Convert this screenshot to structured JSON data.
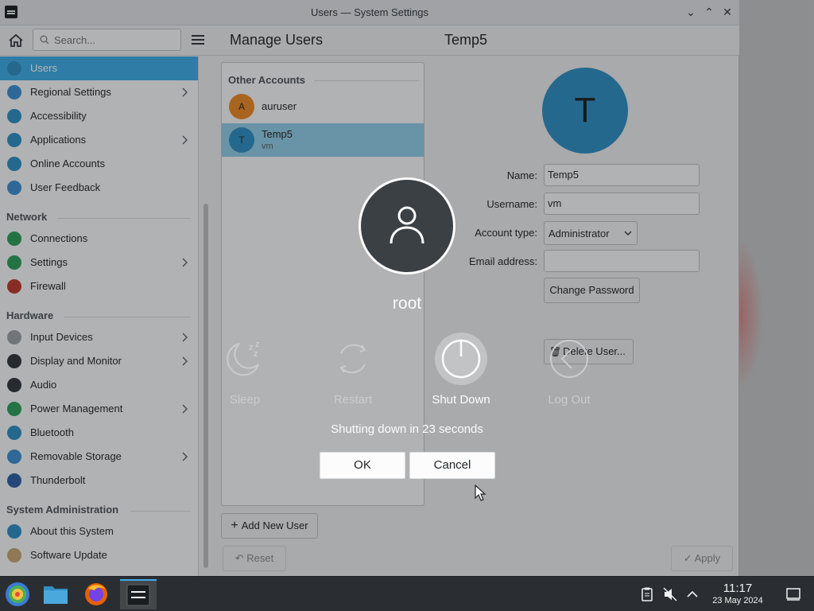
{
  "window": {
    "title": "Users — System Settings"
  },
  "toolbar": {
    "search_placeholder": "Search...",
    "page_title": "Manage Users",
    "user_title": "Temp5"
  },
  "sidebar": {
    "items_top": [
      {
        "label": "Users",
        "icon": "users-icon",
        "color": "#2e8fc4",
        "selected": true,
        "has_children": false
      },
      {
        "label": "Regional Settings",
        "icon": "regional-settings-icon",
        "color": "#3d8fd1",
        "selected": false,
        "has_children": true
      },
      {
        "label": "Accessibility",
        "icon": "accessibility-icon",
        "color": "#2e8fc4",
        "selected": false,
        "has_children": false
      },
      {
        "label": "Applications",
        "icon": "applications-icon",
        "color": "#2e8fc4",
        "selected": false,
        "has_children": true
      },
      {
        "label": "Online Accounts",
        "icon": "online-accounts-icon",
        "color": "#2e8fc4",
        "selected": false,
        "has_children": false
      },
      {
        "label": "User Feedback",
        "icon": "user-feedback-icon",
        "color": "#3d8fd1",
        "selected": false,
        "has_children": false
      }
    ],
    "network_header": "Network",
    "items_network": [
      {
        "label": "Connections",
        "icon": "globe-icon",
        "color": "#2ca05a",
        "has_children": false
      },
      {
        "label": "Settings",
        "icon": "globe-icon",
        "color": "#2ca05a",
        "has_children": true
      },
      {
        "label": "Firewall",
        "icon": "firewall-icon",
        "color": "#c0392b",
        "has_children": false
      }
    ],
    "hardware_header": "Hardware",
    "items_hardware": [
      {
        "label": "Input Devices",
        "icon": "mouse-icon",
        "color": "#9ea3a8",
        "has_children": true
      },
      {
        "label": "Display and Monitor",
        "icon": "monitor-icon",
        "color": "#31363b",
        "has_children": true
      },
      {
        "label": "Audio",
        "icon": "audio-icon",
        "color": "#31363b",
        "has_children": false
      },
      {
        "label": "Power Management",
        "icon": "power-icon",
        "color": "#2ca05a",
        "has_children": true
      },
      {
        "label": "Bluetooth",
        "icon": "bluetooth-icon",
        "color": "#2e8fc4",
        "has_children": false
      },
      {
        "label": "Removable Storage",
        "icon": "usb-icon",
        "color": "#3d8fd1",
        "has_children": true
      },
      {
        "label": "Thunderbolt",
        "icon": "thunderbolt-icon",
        "color": "#2e5fa4",
        "has_children": false
      }
    ],
    "sysadmin_header": "System Administration",
    "items_sysadmin": [
      {
        "label": "About this System",
        "icon": "info-icon",
        "color": "#2e8fc4",
        "has_children": false
      },
      {
        "label": "Software Update",
        "icon": "software-update-icon",
        "color": "#c9a772",
        "has_children": false
      }
    ]
  },
  "accounts": {
    "header": "Other Accounts",
    "list": [
      {
        "initial": "A",
        "name": "auruser",
        "sub": "",
        "color": "#f08a24",
        "selected": false
      },
      {
        "initial": "T",
        "name": "Temp5",
        "sub": "vm",
        "color": "#2e8fc4",
        "selected": true
      }
    ],
    "add_button": "Add New User"
  },
  "user_detail": {
    "avatar_initial": "T",
    "avatar_color": "#2e8fc4",
    "name_label": "Name:",
    "name_value": "Temp5",
    "username_label": "Username:",
    "username_value": "vm",
    "account_type_label": "Account type:",
    "account_type_value": "Administrator",
    "email_label": "Email address:",
    "email_value": "",
    "change_password": "Change Password",
    "delete_user": "Delete User..."
  },
  "footer": {
    "reset": "Reset",
    "apply": "Apply"
  },
  "logout_screen": {
    "user_name": "root",
    "actions": [
      {
        "label": "Sleep",
        "icon": "sleep-icon",
        "active": false
      },
      {
        "label": "Restart",
        "icon": "restart-icon",
        "active": false
      },
      {
        "label": "Shut Down",
        "icon": "shutdown-icon",
        "active": true
      },
      {
        "label": "Log Out",
        "icon": "logout-icon",
        "active": false
      }
    ],
    "countdown": "Shutting down in 23 seconds",
    "ok": "OK",
    "cancel": "Cancel"
  },
  "taskbar": {
    "time": "11:17",
    "date": "23 May 2024"
  }
}
